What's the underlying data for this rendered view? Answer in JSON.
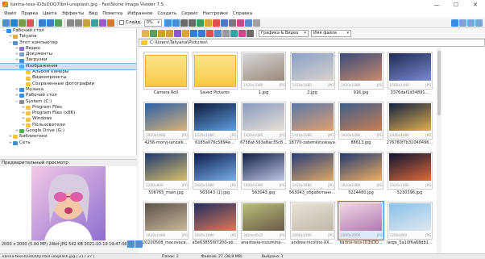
{
  "window": {
    "title": "karina-tess-lD3sDOQ7IbnI-unsplash.jpg - FastStone Image Viewer 7.5",
    "minimize": "—",
    "maximize": "☐",
    "close": "✕"
  },
  "menu": [
    "Файл",
    "Правка",
    "Цвета",
    "Эффекты",
    "Вид",
    "Пометка",
    "Избранное",
    "Создать",
    "Сервис",
    "Настройки",
    "Справка"
  ],
  "toolbar": {
    "slideshow_label": "Слайд.",
    "zoom": "0%",
    "filter": "Графика & Видео",
    "sort": "Имя файла"
  },
  "path": "C:\\Users\\Tatyana\\Pictures\\",
  "tree": [
    {
      "label": "Рабочий стол",
      "level": 0,
      "exp": "−",
      "color": "#3b8fd9"
    },
    {
      "label": "Tatyana",
      "level": 1,
      "exp": "+",
      "color": "#e1a93b"
    },
    {
      "label": "Этот компьютер",
      "level": 1,
      "exp": "−",
      "color": "#5a8fc8"
    },
    {
      "label": "Видео",
      "level": 2,
      "exp": "+",
      "color": "#8a6fc9"
    },
    {
      "label": "Документы",
      "level": 2,
      "exp": "+",
      "color": "#7a9cc0"
    },
    {
      "label": "Загрузки",
      "level": 2,
      "exp": "+",
      "color": "#3b8fd9"
    },
    {
      "label": "Изображения",
      "level": 2,
      "exp": "−",
      "color": "#58a7e6",
      "sel": true
    },
    {
      "label": "Альбом камеры",
      "level": 3,
      "exp": "",
      "color": "#f5c542"
    },
    {
      "label": "Видеопроекты",
      "level": 3,
      "exp": "",
      "color": "#f5c542"
    },
    {
      "label": "Сохраненные фотографии",
      "level": 3,
      "exp": "",
      "color": "#f5c542"
    },
    {
      "label": "Музыка",
      "level": 2,
      "exp": "+",
      "color": "#3b8fd9"
    },
    {
      "label": "Рабочий стол",
      "level": 2,
      "exp": "+",
      "color": "#3b8fd9"
    },
    {
      "label": "System (C:)",
      "level": 2,
      "exp": "−",
      "color": "#8c8c8c"
    },
    {
      "label": "Program Files",
      "level": 3,
      "exp": "+",
      "color": "#f5c542"
    },
    {
      "label": "Program Files (x86)",
      "level": 3,
      "exp": "+",
      "color": "#f5c542"
    },
    {
      "label": "Windows",
      "level": 3,
      "exp": "+",
      "color": "#f5c542"
    },
    {
      "label": "Пользователи",
      "level": 3,
      "exp": "+",
      "color": "#f5c542"
    },
    {
      "label": "Google Drive (G:)",
      "level": 2,
      "exp": "+",
      "color": "#4caf50"
    },
    {
      "label": "Библиотеки",
      "level": 1,
      "exp": "+",
      "color": "#f5c542"
    },
    {
      "label": "Сеть",
      "level": 1,
      "exp": "+",
      "color": "#3b8fd9"
    }
  ],
  "preview": {
    "header": "Предварительный просмотр",
    "info": "2000 x 2000 (5.00 MP)  24bit  JPG  542 KB  2021-10-19 19:47:06"
  },
  "thumbs": [
    {
      "name": "Camera Roll",
      "folder": true
    },
    {
      "name": "Saved Pictures",
      "folder": true
    },
    {
      "name": "1.jpg",
      "size": "1920x1080",
      "ext": "JPG",
      "c1": "#d7d7da",
      "c2": "#9a8a7a"
    },
    {
      "name": "2.jpg",
      "size": "1920x1080",
      "ext": "JPG",
      "c1": "#8aa0c8",
      "c2": "#d9d2cc"
    },
    {
      "name": "916.jpg",
      "size": "1920x1080",
      "ext": "JPG",
      "c1": "#3a4a7a",
      "c2": "#c88a6a"
    },
    {
      "name": "3376daf1d34891...",
      "size": "2560x1440",
      "ext": "JPG",
      "c1": "#1d2a55",
      "c2": "#7a8ad0"
    },
    {
      "name": "4256-moryj-ianzaik...",
      "size": "1920x1080",
      "ext": "JPG",
      "c1": "#2b5fa6",
      "c2": "#d9b37a"
    },
    {
      "name": "6185a076c5894e...",
      "size": "1920x1080",
      "ext": "JPG",
      "c1": "#0e1a3a",
      "c2": "#5f9fe0"
    },
    {
      "name": "6758af-563a8ac35c8...",
      "size": "1920x1080",
      "ext": "JPG",
      "c1": "#8a9ac0",
      "c2": "#e8e0d6"
    },
    {
      "name": "18770-zatemkiruskaya...",
      "size": "1920x1080",
      "ext": "JPG",
      "c1": "#5a78a8",
      "c2": "#e0a070"
    },
    {
      "name": "88613.jpg",
      "size": "1920x1080",
      "ext": "JPG",
      "c1": "#3f5e8a",
      "c2": "#c97e52"
    },
    {
      "name": "276760f7b31040496...",
      "size": "1920x1080",
      "ext": "JPG",
      "c1": "#13213f",
      "c2": "#e0b050"
    },
    {
      "name": "506765_main.jpg",
      "size": "1200x800",
      "ext": "JPG",
      "c1": "#1e3870",
      "c2": "#d9c06a"
    },
    {
      "name": "563043 (1).jpg",
      "size": "1920x1080",
      "ext": "JPG",
      "c1": "#0a1a4a",
      "c2": "#7ab0e8"
    },
    {
      "name": "563043.jpg",
      "size": "1920x1080",
      "ext": "JPG",
      "c1": "#101d45",
      "c2": "#c0c8e8"
    },
    {
      "name": "563043_обработанн...",
      "size": "1920x1080",
      "ext": "JPG",
      "c1": "#2a3c78",
      "c2": "#ddaa66"
    },
    {
      "name": "5224480.jpg",
      "size": "1920x1080",
      "ext": "JPG",
      "c1": "#233a72",
      "c2": "#f0b060"
    },
    {
      "name": "5230396.jpg",
      "size": "1920x1080",
      "ext": "JPG",
      "c1": "#0c1430",
      "c2": "#e06a3a"
    },
    {
      "name": "20200508_macovaca...",
      "size": "1920x1080",
      "ext": "JPG",
      "c1": "#5a5248",
      "c2": "#c9b89a"
    },
    {
      "name": "a5e638556f7200-ab...",
      "size": "1920x1080",
      "ext": "JPG",
      "c1": "#1e2c5c",
      "c2": "#e07a5a"
    },
    {
      "name": "anastasia-rozumina-...",
      "size": "3024x4032",
      "ext": "JPG",
      "c1": "#b9c07a",
      "c2": "#6a5a4a"
    },
    {
      "name": "andrea-nicolino-XX...",
      "size": "2000x1500",
      "ext": "JPG",
      "c1": "#e8e2d6",
      "c2": "#c0b8a8"
    },
    {
      "name": "karina-tess-lD3sDO...",
      "size": "2000x2000",
      "ext": "JPG",
      "c1": "#f0d6e6",
      "c2": "#b07ab0",
      "current": true
    },
    {
      "name": "large_5a10f6a68db1...",
      "size": "1200x800",
      "ext": "JPG",
      "c1": "#8ac0e8",
      "c2": "#e0e8f0"
    }
  ],
  "status": {
    "path": "karina-tess-lD3sDOQ7IbnI-unsplash.jpg [ 21 / 27 ]",
    "folders": "Папок: 2",
    "files": "Файлов: 27 (38,8 MB)",
    "selected": "Выбрано: 1"
  },
  "accent": "#3a8de0"
}
